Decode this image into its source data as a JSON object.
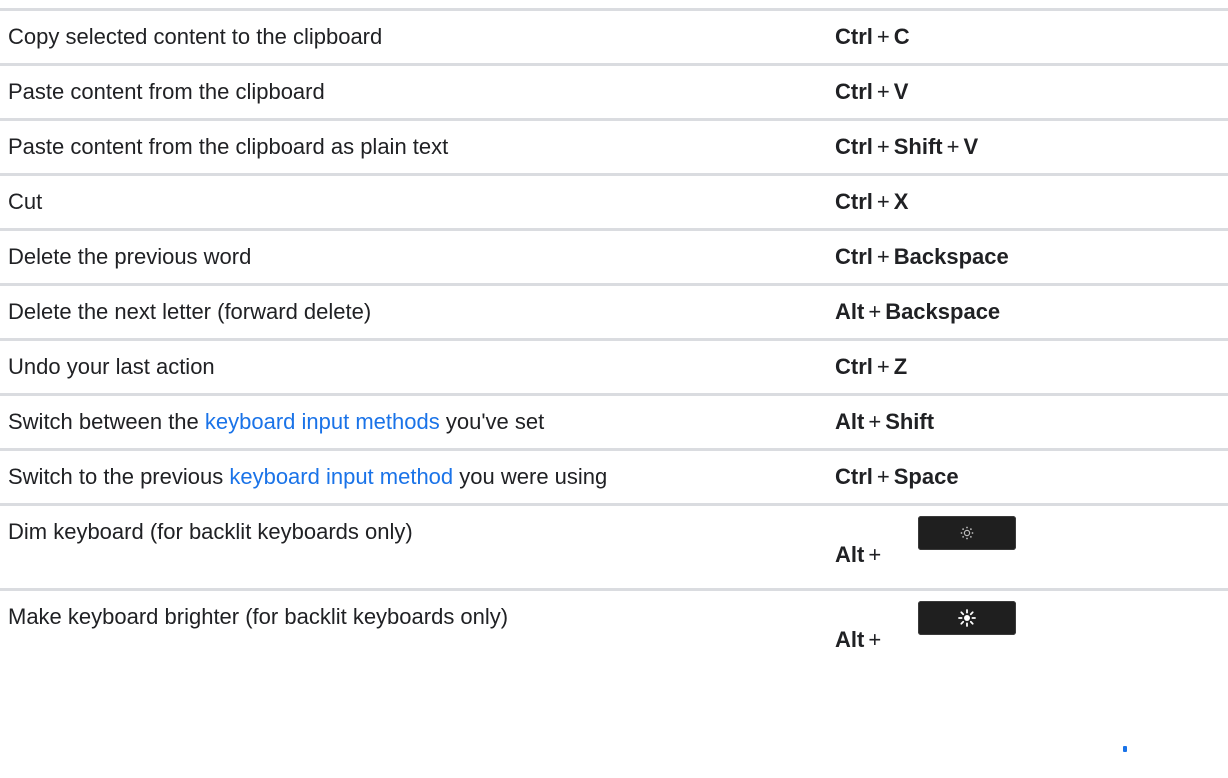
{
  "shortcuts": [
    {
      "description": "Copy selected content to the clipboard",
      "keys": [
        "Ctrl",
        "C"
      ]
    },
    {
      "description": "Paste content from the clipboard",
      "keys": [
        "Ctrl",
        "V"
      ]
    },
    {
      "description": "Paste content from the clipboard as plain text",
      "keys": [
        "Ctrl",
        "Shift",
        "V"
      ]
    },
    {
      "description": "Cut",
      "keys": [
        "Ctrl",
        "X"
      ]
    },
    {
      "description": "Delete the previous word",
      "keys": [
        "Ctrl",
        "Backspace"
      ]
    },
    {
      "description": "Delete the next letter (forward delete)",
      "keys": [
        "Alt",
        "Backspace"
      ]
    },
    {
      "description": "Undo your last action",
      "keys": [
        "Ctrl",
        "Z"
      ]
    },
    {
      "description_before": "Switch between the ",
      "description_link": "keyboard input methods",
      "description_after": " you've set",
      "keys": [
        "Alt",
        "Shift"
      ]
    },
    {
      "description_before": "Switch to the previous ",
      "description_link": "keyboard input method",
      "description_after": " you were using",
      "keys": [
        "Ctrl",
        "Space"
      ]
    },
    {
      "description": "Dim keyboard (for backlit keyboards only)",
      "keys": [
        "Alt"
      ],
      "key_icon": "brightness-down-key-icon"
    },
    {
      "description": "Make keyboard brighter (for backlit keyboards only)",
      "keys": [
        "Alt"
      ],
      "key_icon": "brightness-up-key-icon"
    }
  ],
  "plus_sign": "+",
  "colors": {
    "link": "#1a73e8",
    "divider": "#dadce0",
    "keycap": "#1f1f1f",
    "text": "#202124"
  }
}
